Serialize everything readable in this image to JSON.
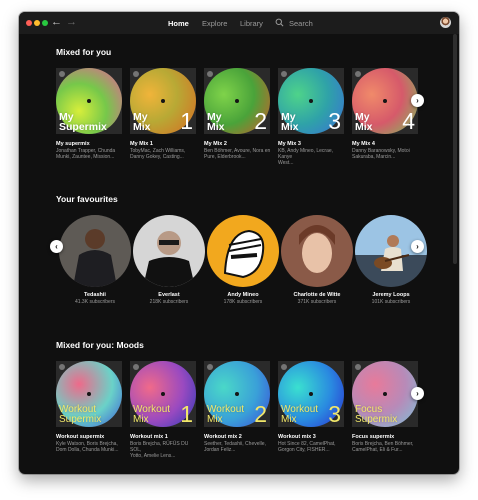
{
  "nav": {
    "back_icon": "‹-arrow",
    "tabs": [
      {
        "label": "Home",
        "active": true
      },
      {
        "label": "Explore",
        "active": false
      },
      {
        "label": "Library",
        "active": false
      }
    ],
    "search_label": "Search"
  },
  "sections": {
    "mixed_for_you": {
      "title": "Mixed for you",
      "cards": [
        {
          "cover_line": "My\nSupermix",
          "cover_num": "",
          "title": "My supermix",
          "sub": "Jonathan Trapper, Chunda\nMunki, Zauntee, Mission..."
        },
        {
          "cover_line": "My\nMix",
          "cover_num": "1",
          "title": "My Mix 1",
          "sub": "TobyMac, Zach Williams,\nDanny Gokey, Casting..."
        },
        {
          "cover_line": "My\nMix",
          "cover_num": "2",
          "title": "My Mix 2",
          "sub": "Ben Böhmer, Avoure, Nora en\nPure, Elderbrook..."
        },
        {
          "cover_line": "My\nMix",
          "cover_num": "3",
          "title": "My Mix 3",
          "sub": "KB, Andy Mineo, Lecrae, Kanye\nWest..."
        },
        {
          "cover_line": "My\nMix",
          "cover_num": "4",
          "title": "My Mix 4",
          "sub": "Danny Baranowsky, Motoi\nSakuraba, Marcin..."
        }
      ]
    },
    "your_favourites": {
      "title": "Your favourites",
      "artists": [
        {
          "name": "Tedashii",
          "sub": "41.3K subscribers"
        },
        {
          "name": "Everlast",
          "sub": "218K subscribers"
        },
        {
          "name": "Andy Mineo",
          "sub": "178K subscribers"
        },
        {
          "name": "Charlotte de Witte",
          "sub": "371K subscribers"
        },
        {
          "name": "Jeremy Loops",
          "sub": "101K subscribers"
        }
      ]
    },
    "moods": {
      "title": "Mixed for you: Moods",
      "cards": [
        {
          "cover_line": "Workout\nSupermix",
          "cover_num": "",
          "title": "Workout supermix",
          "sub": "Kyle Watson, Boris Brejcha,\nDom Dolla, Chunda Munki..."
        },
        {
          "cover_line": "Workout\nMix",
          "cover_num": "1",
          "title": "Workout mix 1",
          "sub": "Boris Brejcha, RÜFÜS DU SOL,\nYotto, Amelie Lens..."
        },
        {
          "cover_line": "Workout\nMix",
          "cover_num": "2",
          "title": "Workout mix 2",
          "sub": "Seether, Tedashii, Chevelle,\nJordan Feliz..."
        },
        {
          "cover_line": "Workout\nMix",
          "cover_num": "3",
          "title": "Workout mix 3",
          "sub": "Hot Since 82, CamelPhat,\nGorgon City, FISHER..."
        },
        {
          "cover_line": "Focus\nSupermix",
          "cover_num": "",
          "title": "Focus supermix",
          "sub": "Boris Brejcha, Ben Böhmer,\nCamelPhat, Eli & Fur..."
        }
      ]
    }
  },
  "colors": {
    "background": "#101010",
    "titlebar": "#1c1c1c",
    "text_primary": "#ffffff",
    "text_secondary": "#9a9a9a",
    "mood_text": "#f2e86a"
  }
}
